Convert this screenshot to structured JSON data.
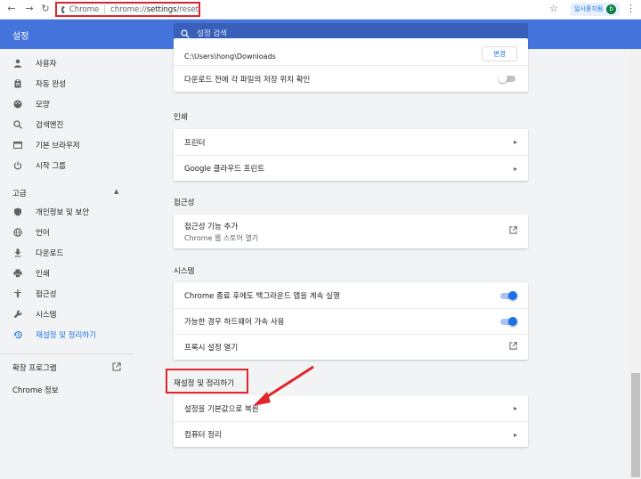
{
  "address_bar": {
    "chrome_label": "Chrome",
    "separator": "|",
    "url_prefix": "chrome://",
    "url_path": "settings",
    "url_suffix": "/reset",
    "paused_label": "일시중지됨",
    "avatar_letter": "b"
  },
  "header": {
    "title": "설정",
    "search_placeholder": "설정 검색",
    "bg_color": "#4573dc"
  },
  "sidebar": {
    "items": [
      {
        "label": "사용자",
        "icon": "person-icon"
      },
      {
        "label": "자동 완성",
        "icon": "clipboard-icon"
      },
      {
        "label": "모양",
        "icon": "palette-icon"
      },
      {
        "label": "검색엔진",
        "icon": "search-icon"
      },
      {
        "label": "기본 브라우저",
        "icon": "browser-icon"
      },
      {
        "label": "시작 그룹",
        "icon": "power-icon"
      }
    ],
    "advanced_label": "고급",
    "advanced_items": [
      {
        "label": "개인정보 및 보안",
        "icon": "shield-icon"
      },
      {
        "label": "언어",
        "icon": "globe-icon"
      },
      {
        "label": "다운로드",
        "icon": "download-icon"
      },
      {
        "label": "인쇄",
        "icon": "printer-icon"
      },
      {
        "label": "접근성",
        "icon": "accessibility-icon"
      },
      {
        "label": "시스템",
        "icon": "wrench-icon"
      },
      {
        "label": "재설정 및 정리하기",
        "icon": "restore-icon",
        "active": true
      }
    ],
    "extensions_label": "확장 프로그램",
    "about_label": "Chrome 정보"
  },
  "main": {
    "downloads": {
      "path": "C:\\Users\\hong\\Downloads",
      "change_label": "변경",
      "ask_label": "다운로드 전에 각 파일의 저장 위치 확인"
    },
    "print": {
      "title": "인쇄",
      "rows": [
        "프린터",
        "Google 클라우드 프린트"
      ]
    },
    "accessibility": {
      "title": "접근성",
      "add_label": "접근성 기능 추가",
      "add_sub": "Chrome 웹 스토어 열기"
    },
    "system": {
      "title": "시스템",
      "background_label": "Chrome 종료 후에도 백그라운드 앱을 계속 실행",
      "hardware_label": "가능한 경우 하드웨어 가속 사용",
      "proxy_label": "프록시 설정 열기"
    },
    "reset": {
      "title": "재설정 및 정리하기",
      "restore_label": "설정을 기본값으로 복원",
      "cleanup_label": "컴퓨터 정리"
    }
  },
  "colors": {
    "accent": "#1a73e8",
    "highlight_red": "#e0242b"
  }
}
